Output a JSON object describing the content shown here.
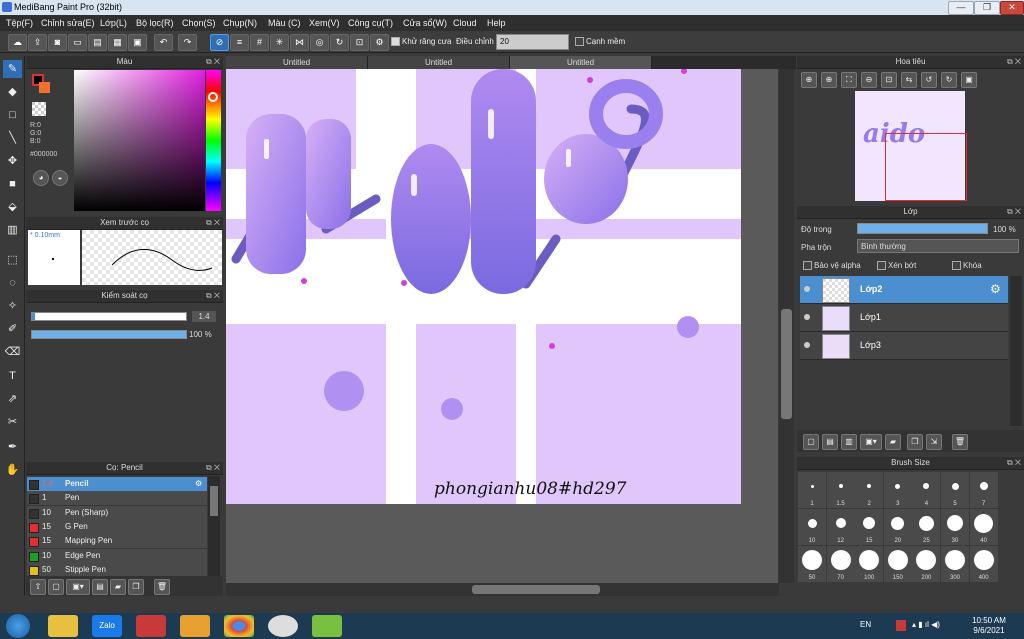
{
  "window": {
    "title": "MediBang Paint Pro (32bit)",
    "min": "—",
    "max": "❐",
    "close": "✕"
  },
  "menu": [
    "Tệp(F)",
    "Chỉnh sửa(E)",
    "Lớp(L)",
    "Bộ lọc(R)",
    "Chọn(S)",
    "Chụp(N)",
    "Màu (C)",
    "Xem(V)",
    "Công cụ(T)",
    "Cửa sổ(W)",
    "Cloud",
    "Help"
  ],
  "toolbar": {
    "antialias_label": "Khử răng cưa",
    "adjust_label": "Điều chỉnh",
    "adjust_value": "20",
    "edge_label": "Cạnh mềm"
  },
  "tabs": [
    "Untitled",
    "Untitled",
    "Untitled"
  ],
  "color_panel": {
    "title": "Màu",
    "rgb": [
      "R:0",
      "G:0",
      "B:0"
    ],
    "hex": "#000000"
  },
  "brush_preview": {
    "title": "Xem trước cọ",
    "size_label": "* 0.10mm"
  },
  "brush_control": {
    "title": "Kiểm soát cọ",
    "size_value": "1.4",
    "opacity_value": "100 %"
  },
  "brush_list": {
    "title": "Cọ: Pencil",
    "items": [
      {
        "size": "1.4",
        "name": "Pencil",
        "color": "#333333"
      },
      {
        "size": "1",
        "name": "Pen",
        "color": "#333333"
      },
      {
        "size": "10",
        "name": "Pen (Sharp)",
        "color": "#333333"
      },
      {
        "size": "15",
        "name": "G Pen",
        "color": "#e03030"
      },
      {
        "size": "15",
        "name": "Mapping Pen",
        "color": "#e03030"
      },
      {
        "size": "10",
        "name": "Edge Pen",
        "color": "#20a020"
      },
      {
        "size": "50",
        "name": "Stipple Pen",
        "color": "#e0c020"
      }
    ]
  },
  "navigator": {
    "title": "Hoa tiêu"
  },
  "layer_panel": {
    "title": "Lớp",
    "opacity_label": "Độ trong",
    "opacity_value": "100 %",
    "blend_label": "Pha trộn",
    "blend_value": "Bình thường",
    "protect_alpha": "Bảo vệ alpha",
    "clipping": "Xén bớt",
    "lock": "Khóa",
    "layers": [
      {
        "name": "Lớp2"
      },
      {
        "name": "Lớp1"
      },
      {
        "name": "Lớp3"
      }
    ]
  },
  "brush_size": {
    "title": "Brush Size",
    "sizes": [
      "1",
      "1.5",
      "2",
      "3",
      "4",
      "5",
      "7",
      "10",
      "12",
      "15",
      "20",
      "25",
      "30",
      "40",
      "50",
      "70",
      "100",
      "150",
      "200",
      "300",
      "400"
    ]
  },
  "artwork": {
    "signature": "phongianhu08#hd297"
  },
  "taskbar": {
    "lang": "EN",
    "time": "10:50 AM",
    "date": "9/6/2021"
  }
}
